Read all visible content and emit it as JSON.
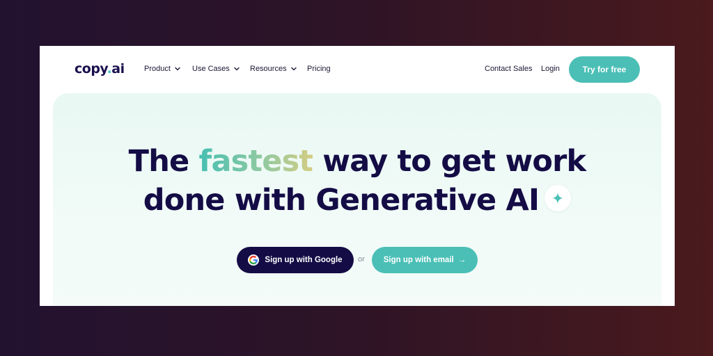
{
  "nav": {
    "logo_main": "copy",
    "logo_dot": ".",
    "logo_suffix": "ai",
    "links": [
      {
        "label": "Product",
        "has_dropdown": true
      },
      {
        "label": "Use Cases",
        "has_dropdown": true
      },
      {
        "label": "Resources",
        "has_dropdown": true
      },
      {
        "label": "Pricing",
        "has_dropdown": false
      }
    ],
    "contact_sales": "Contact Sales",
    "login": "Login",
    "try_free": "Try for free"
  },
  "hero": {
    "headline_part1": "The ",
    "headline_highlight": "fastest",
    "headline_part2": " way to get work",
    "headline_line2": "done with Generative AI",
    "google_button": "Sign up with Google",
    "or_text": "or",
    "email_button": "Sign up with email",
    "email_arrow": "→"
  },
  "icons": {
    "chevron": "chevron-down-icon",
    "sparkle": "sparkle-icon",
    "google": "google-icon",
    "arrow": "arrow-right-icon"
  },
  "colors": {
    "brand_dark": "#140c45",
    "accent_teal": "#4bbfb6",
    "hero_bg": "#e9f8f3"
  }
}
